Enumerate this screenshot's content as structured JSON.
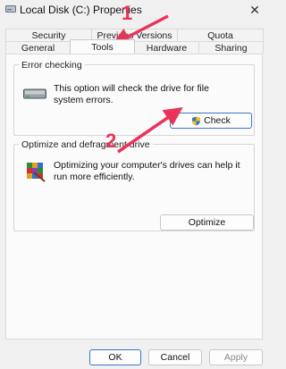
{
  "window": {
    "title": "Local Disk (C:) Properties",
    "close_symbol": "✕"
  },
  "tabs": {
    "row1": [
      "Security",
      "Previous Versions",
      "Quota"
    ],
    "row2": [
      "General",
      "Tools",
      "Hardware",
      "Sharing"
    ],
    "active": "Tools"
  },
  "error_checking": {
    "title": "Error checking",
    "description": "This option will check the drive for file system errors.",
    "check_button": "Check",
    "icon": "hard-drive-icon"
  },
  "optimize": {
    "title": "Optimize and defragment drive",
    "description": "Optimizing your computer's drives can help it run more efficiently.",
    "optimize_button": "Optimize",
    "icon": "defrag-icon"
  },
  "footer": {
    "ok": "OK",
    "cancel": "Cancel",
    "apply": "Apply"
  },
  "annotations": {
    "step1": "1",
    "step2": "2",
    "color": "#e8345a"
  }
}
